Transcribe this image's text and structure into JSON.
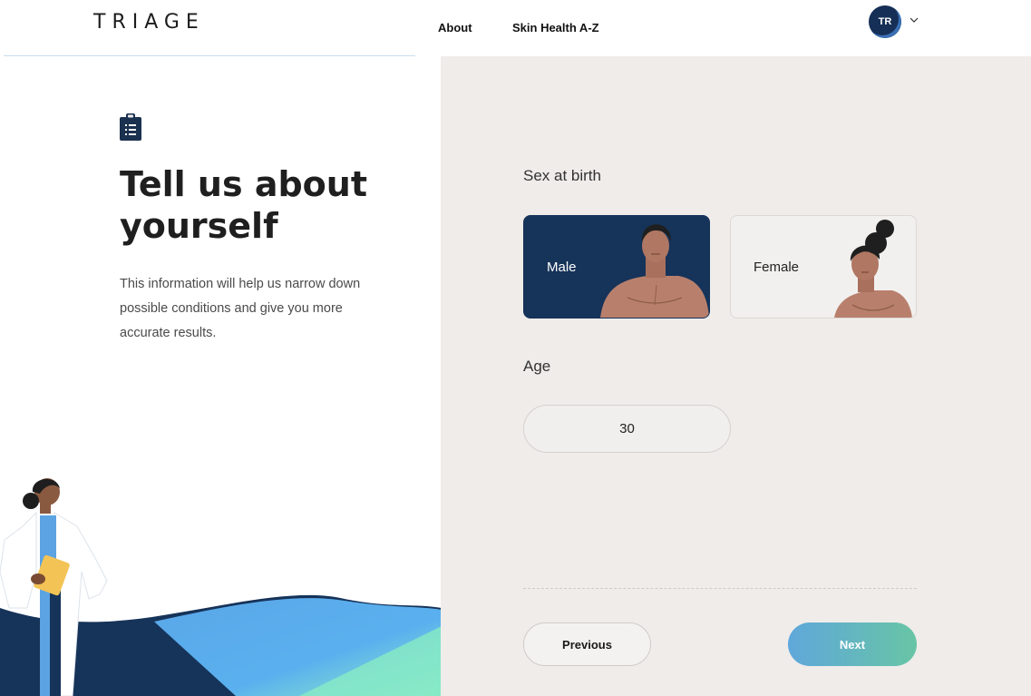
{
  "header": {
    "logo": "TRIAGE",
    "nav": [
      {
        "label": "About"
      },
      {
        "label": "Skin Health A-Z"
      }
    ],
    "user": {
      "initials": "TR"
    }
  },
  "intro": {
    "title": "Tell us about yourself",
    "description": "This information will help us narrow down possible conditions and give you more accurate results."
  },
  "form": {
    "sex_label": "Sex at birth",
    "sex_options": [
      {
        "label": "Male",
        "selected": true
      },
      {
        "label": "Female",
        "selected": false
      }
    ],
    "age_label": "Age",
    "age_value": "30"
  },
  "actions": {
    "previous": "Previous",
    "next": "Next"
  },
  "colors": {
    "navy": "#163359",
    "panel_bg": "#efecea",
    "next_gradient_start": "#5fa7db",
    "next_gradient_end": "#68c5a5"
  }
}
